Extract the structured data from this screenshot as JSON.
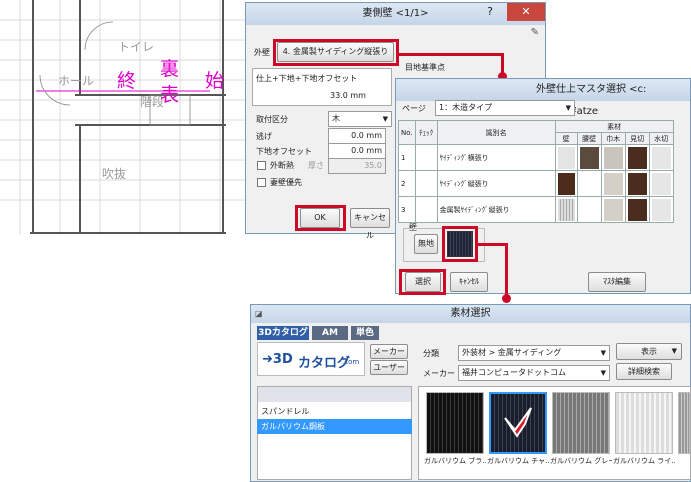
{
  "plan": {
    "toilet": "トイレ",
    "hall": "ホール",
    "stairs": "階段",
    "void": "吹抜",
    "end": "終",
    "back": "裏",
    "front": "表",
    "start": "始"
  },
  "dialog1": {
    "title": "妻側壁 <1/1>",
    "help": "?",
    "close": "✕",
    "outer_wall_label": "外壁",
    "outer_wall_value": "4. 金属製サイディング縦張り",
    "baseline_label": "目地基準点",
    "finish_label": "仕上+下地+下地オフセット",
    "finish_value": "33.0 mm",
    "mount_label": "取付区分",
    "mount_value": "木",
    "nige_label": "逃げ",
    "nige_value": "0.0 mm",
    "substrate_label": "下地オフセット",
    "substrate_value": "0.0 mm",
    "insulation_label": "外断熱",
    "thickness_label": "厚さ",
    "thickness_value": "35.0",
    "gable_label": "妻壁優先",
    "ok": "OK",
    "cancel": "キャンセル"
  },
  "dialog2": {
    "title": "外壁仕上マスタ選択 <c:¥fcapp¥atze",
    "page_label": "ページ",
    "page_value": "1：木造タイプ",
    "headers": {
      "no": "No.",
      "check": "ﾁｪｯｸ",
      "name": "識別名",
      "material": "素材",
      "wall": "壁",
      "koshikabe": "腰壁",
      "habaki": "巾木",
      "mikiri": "見切",
      "mizukiri": "水切"
    },
    "rows": [
      {
        "no": "1",
        "name": "ｻｲﾃﾞｨﾝｸﾞ横張り"
      },
      {
        "no": "2",
        "name": "ｻｲﾃﾞｨﾝｸﾞ縦張り"
      },
      {
        "no": "3",
        "name": "金属製ｻｲﾃﾞｨﾝｸﾞ縦張り"
      }
    ],
    "wall_group": "壁",
    "no_base": "無地",
    "select": "選択",
    "cancel": "ｷｬﾝｾﾙ",
    "master_edit": "ﾏｽﾀ編集"
  },
  "dialog3": {
    "title": "素材選択",
    "tabs": [
      "3Dカタログ",
      "AM",
      "単色"
    ],
    "logo_arrow": "➜3D",
    "logo_text": "カタログ",
    "logo_dotcom": ".com",
    "maker_btn": "メーカー",
    "user_btn": "ユーザー",
    "category_label": "分類",
    "category_value": "外装材 > 金属サイディング",
    "display_btn": "表示",
    "maker_label": "メーカー",
    "maker_value": "福井コンピュータドットコム",
    "detail_search": "詳細検索",
    "list": [
      "スパンドレル",
      "ガルバリウム鋼板"
    ],
    "thumbs": [
      "ガルバリウム ブラ…",
      "ガルバリウム チャ…",
      "ガルバリウム グレー",
      "ガルバリウム ライ…"
    ]
  },
  "colors": {
    "accent_red": "#cc0a28",
    "selection_blue": "#3399ff",
    "magenta_text": "#e000c8"
  }
}
